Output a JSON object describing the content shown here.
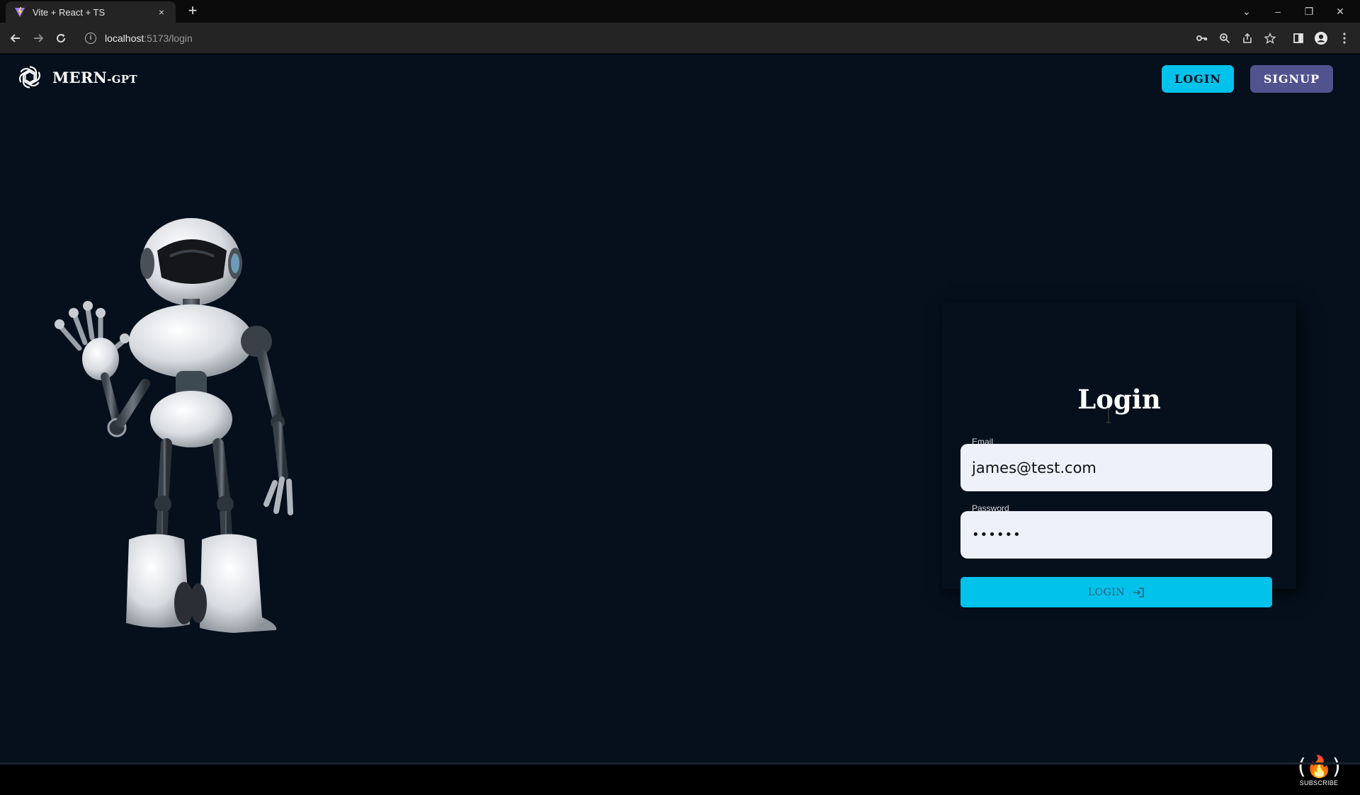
{
  "browser": {
    "tab_title": "Vite + React + TS",
    "tab_close": "×",
    "new_tab": "+",
    "url_host": "localhost",
    "url_path": ":5173/login",
    "window_controls": [
      "⌄",
      "–",
      "❐",
      "✕"
    ],
    "toolbar_icons": [
      "key-icon",
      "zoom-icon",
      "share-icon",
      "star-icon",
      "sidepanel-icon",
      "profile-icon",
      "menu-icon"
    ]
  },
  "header": {
    "brand_name": "MERN",
    "brand_suffix": "-GPT",
    "login_label": "LOGIN",
    "signup_label": "SIGNUP"
  },
  "login_form": {
    "title": "Login",
    "email_label": "Email",
    "email_value": "james@test.com",
    "password_label": "Password",
    "password_value": "••••••",
    "submit_label": "LOGIN"
  },
  "subscribe": {
    "label": "SUBSCRIBE"
  },
  "colors": {
    "page_bg": "#05101c",
    "accent": "#00c2eb",
    "signup_bg": "#51538f"
  }
}
